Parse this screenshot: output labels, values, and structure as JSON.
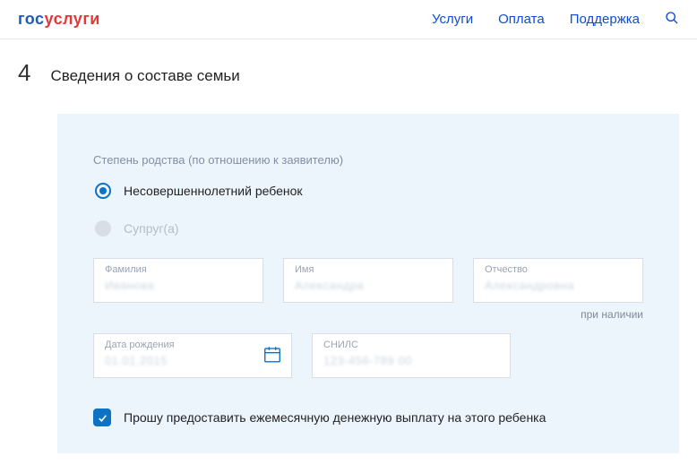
{
  "header": {
    "logo_gos": "гос",
    "logo_uslugi": "услуги",
    "nav": {
      "services": "Услуги",
      "payment": "Оплата",
      "support": "Поддержка"
    }
  },
  "section": {
    "step": "4",
    "title": "Сведения о составе семьи"
  },
  "form": {
    "relationship_label": "Степень родства (по отношению к заявителю)",
    "radio_child": "Несовершеннолетний ребенок",
    "radio_spouse": "Супруг(а)",
    "fields": {
      "surname": {
        "label": "Фамилия",
        "value": "Иванова"
      },
      "name": {
        "label": "Имя",
        "value": "Александра"
      },
      "patronymic": {
        "label": "Отчество",
        "value": "Александровна"
      },
      "birthdate": {
        "label": "Дата рождения",
        "value": "01.01.2015"
      },
      "snils": {
        "label": "СНИЛС",
        "value": "123-456-789 00"
      }
    },
    "hint": "при наличии",
    "checkbox_label": "Прошу предоставить ежемесячную денежную выплату на этого ребенка"
  }
}
